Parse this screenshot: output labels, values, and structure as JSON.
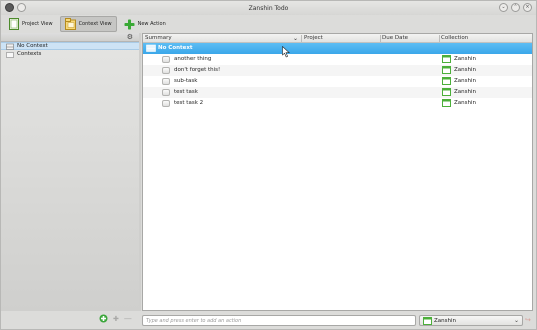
{
  "window": {
    "title": "Zanshin Todo"
  },
  "toolbar": {
    "project_view_label": "Project View",
    "context_view_label": "Context View",
    "new_action_label": "New Action"
  },
  "sidebar": {
    "items": [
      {
        "label": "No Context",
        "selected": true
      },
      {
        "label": "Contexts",
        "selected": false
      }
    ]
  },
  "table": {
    "columns": {
      "summary": "Summary",
      "project": "Project",
      "due_date": "Due Date",
      "collection": "Collection"
    },
    "group_label": "No Context",
    "rows": [
      {
        "summary": "another thing",
        "project": "",
        "due_date": "",
        "collection": "Zanshin"
      },
      {
        "summary": "don't forget this!",
        "project": "",
        "due_date": "",
        "collection": "Zanshin"
      },
      {
        "summary": "sub-task",
        "project": "",
        "due_date": "",
        "collection": "Zanshin"
      },
      {
        "summary": "test task",
        "project": "",
        "due_date": "",
        "collection": "Zanshin"
      },
      {
        "summary": "test task 2",
        "project": "",
        "due_date": "",
        "collection": "Zanshin"
      }
    ]
  },
  "bottom": {
    "add_placeholder": "Type and press enter to add an action",
    "collection_selected": "Zanshin"
  },
  "colors": {
    "selection_blue": "#3aa7ea",
    "tree_selection": "#cde3f5",
    "calendar_green": "#4caf3a"
  }
}
